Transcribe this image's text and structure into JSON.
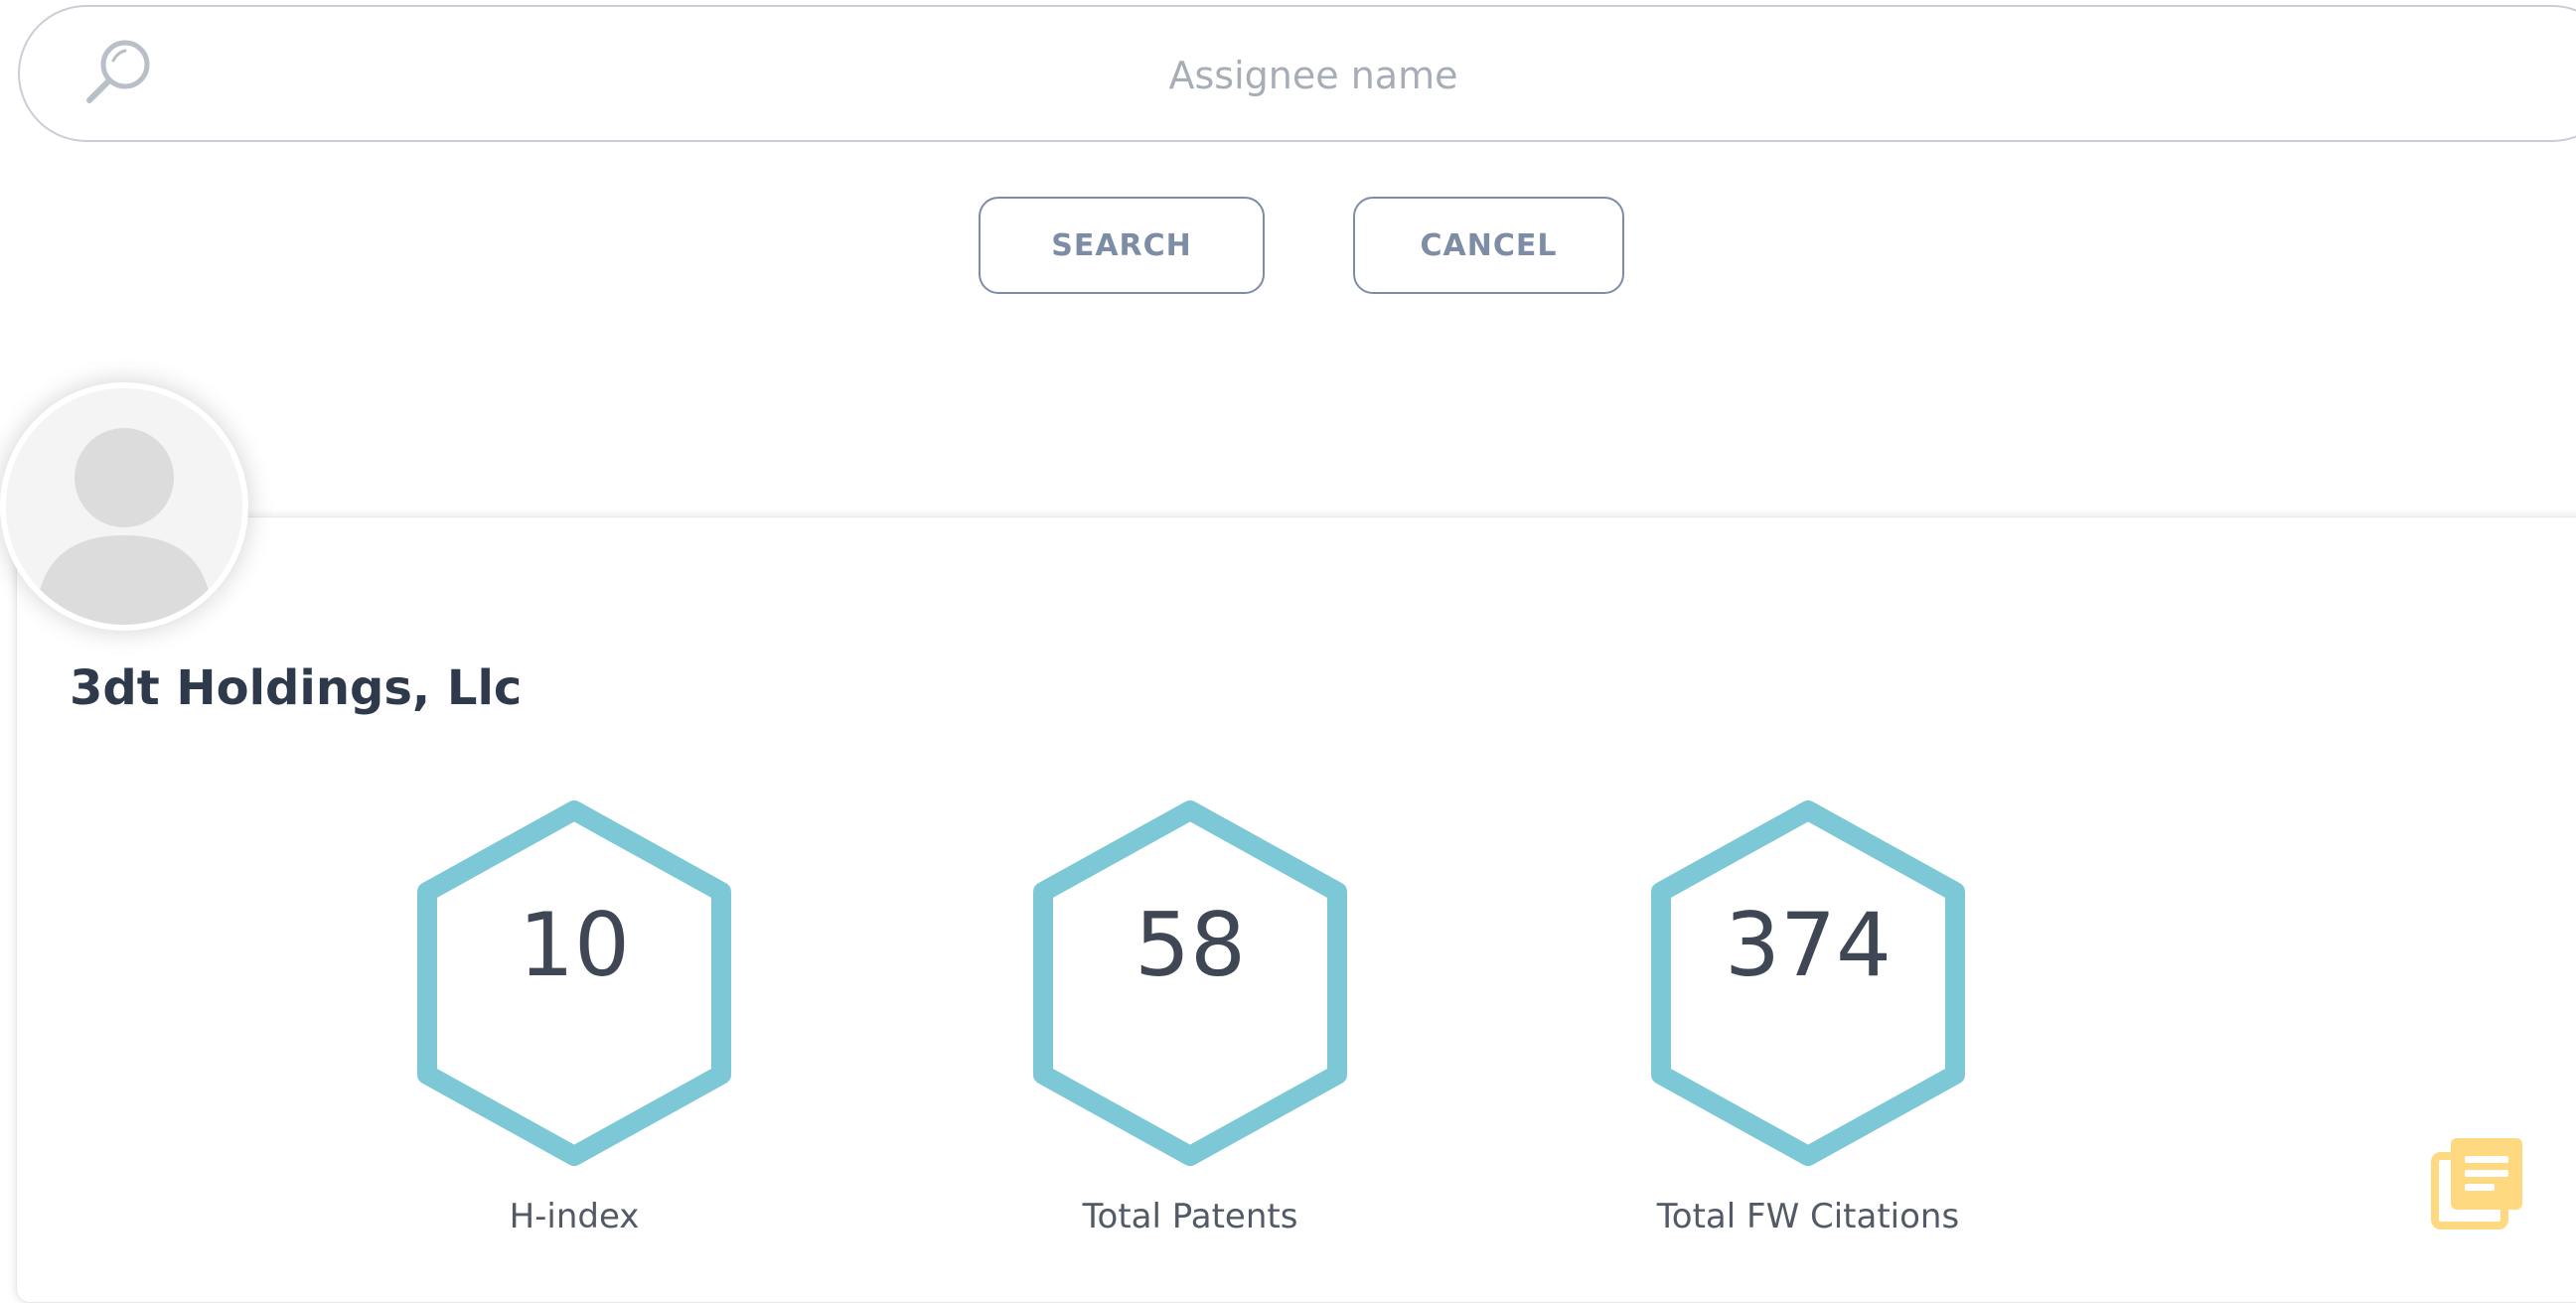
{
  "search": {
    "placeholder": "Assignee name",
    "value": ""
  },
  "buttons": {
    "search_label": "SEARCH",
    "cancel_label": "CANCEL"
  },
  "profile": {
    "name": "3dt Holdings, Llc"
  },
  "stats": [
    {
      "value": "10",
      "label": "H-index"
    },
    {
      "value": "58",
      "label": "Total Patents"
    },
    {
      "value": "374",
      "label": "Total FW Citations"
    }
  ],
  "icons": {
    "search": "search-icon",
    "avatar": "user-avatar-icon",
    "report": "report-list-icon"
  },
  "colors": {
    "hexagon_stroke": "#7cc8d6",
    "button_border": "#7d8da6",
    "report_icon": "#ffd980",
    "name_text": "#2e3a4b"
  }
}
